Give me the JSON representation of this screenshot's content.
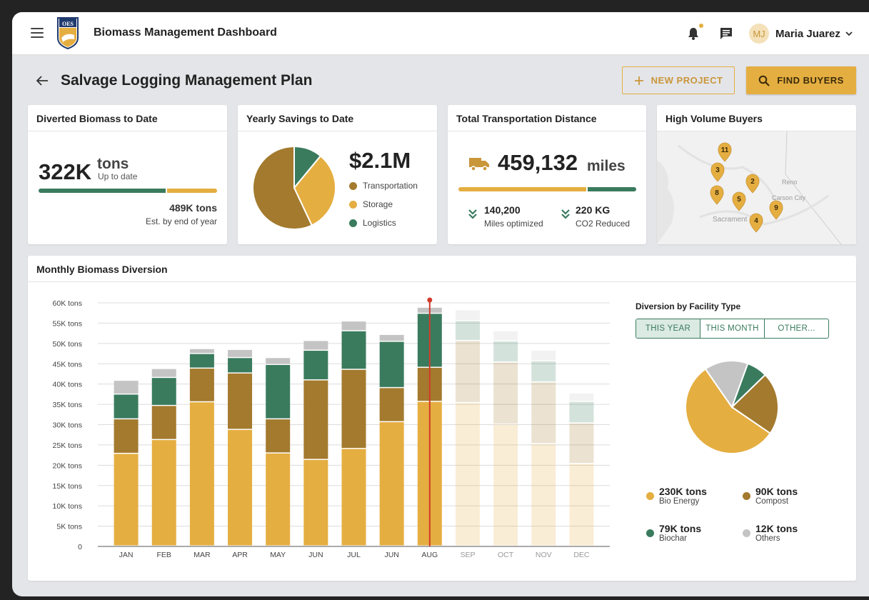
{
  "app": {
    "title": "Biomass Management Dashboard",
    "logo_text": "OES"
  },
  "user": {
    "initials": "MJ",
    "name": "Maria Juarez"
  },
  "page": {
    "title": "Salvage Logging Management Plan",
    "new_project": "NEW PROJECT",
    "find_buyers": "FIND BUYERS"
  },
  "colors": {
    "green": "#3a7b5e",
    "gold": "#e5ae41",
    "brown": "#a37a2e",
    "gray": "#c4c4c4"
  },
  "diverted": {
    "title": "Diverted Biomass to Date",
    "value": "322K",
    "unit": "tons",
    "sub": "Up to date",
    "target": "489K tons",
    "target_note": "Est. by end of year",
    "progress": 0.71
  },
  "savings": {
    "title": "Yearly Savings to Date",
    "value": "$2.1M",
    "legend": [
      {
        "label": "Transportation",
        "color": "#a37a2e",
        "share": 0.57
      },
      {
        "label": "Storage",
        "color": "#e5ae41",
        "share": 0.32
      },
      {
        "label": "Logistics",
        "color": "#3a7b5e",
        "share": 0.11
      }
    ]
  },
  "transport": {
    "title": "Total Transportation Distance",
    "value": "459,132",
    "unit": "miles",
    "progress": 0.72,
    "stat1_value": "140,200",
    "stat1_label": "Miles optimized",
    "stat2_value": "220 KG",
    "stat2_label": "CO2 Reduced"
  },
  "buyers": {
    "title": "High Volume Buyers",
    "city_labels": [
      "Reno",
      "Carson City",
      "Sacrament"
    ],
    "pins": [
      "11",
      "3",
      "2",
      "8",
      "5",
      "9",
      "4"
    ]
  },
  "monthly": {
    "title": "Monthly Biomass Diversion"
  },
  "facility": {
    "title": "Diversion by Facility Type",
    "tabs": [
      "THIS YEAR",
      "THIS MONTH",
      "OTHER..."
    ],
    "legend": [
      {
        "value": "230K tons",
        "label": "Bio Energy",
        "color": "#e5ae41",
        "share": 0.558
      },
      {
        "value": "90K tons",
        "label": "Compost",
        "color": "#a37a2e",
        "share": 0.218
      },
      {
        "value": "79K tons",
        "label": "Biochar",
        "color": "#3a7b5e",
        "share": 0.072
      },
      {
        "value": "12K tons",
        "label": "Others",
        "color": "#c4c4c4",
        "share": 0.152
      }
    ]
  },
  "chart_data": {
    "type": "bar",
    "stacked": true,
    "categories": [
      "JAN",
      "FEB",
      "MAR",
      "APR",
      "MAY",
      "JUN",
      "JUL",
      "JUN",
      "AUG",
      "SEP",
      "OCT",
      "NOV",
      "DEC"
    ],
    "y_tick_labels": [
      "0",
      "5K tons",
      "10K tons",
      "15K tons",
      "20K tons",
      "25K tons",
      "30K tons",
      "35K tons",
      "40K tons",
      "45K tons",
      "50K tons",
      "55K tons",
      "60K tons"
    ],
    "ylim": [
      0,
      60000
    ],
    "current_month_index": 8,
    "projected_from_index": 9,
    "series": [
      {
        "color": "#e5ae41",
        "values": [
          22800,
          26200,
          35500,
          28700,
          22900,
          21300,
          24000,
          30600,
          35600,
          35300,
          30000,
          25200,
          20300
        ]
      },
      {
        "color": "#a37a2e",
        "values": [
          8500,
          8400,
          8300,
          13900,
          8400,
          19600,
          19500,
          8400,
          8400,
          15300,
          15300,
          15200,
          10000
        ]
      },
      {
        "color": "#3a7b5e",
        "values": [
          6100,
          6900,
          3600,
          3800,
          13400,
          7300,
          9500,
          11400,
          13300,
          4900,
          5200,
          5200,
          5300
        ]
      },
      {
        "color": "#c4c4c4",
        "values": [
          3400,
          2200,
          1200,
          2000,
          1700,
          2400,
          2400,
          1700,
          1500,
          2700,
          2500,
          2600,
          2100
        ]
      }
    ]
  }
}
